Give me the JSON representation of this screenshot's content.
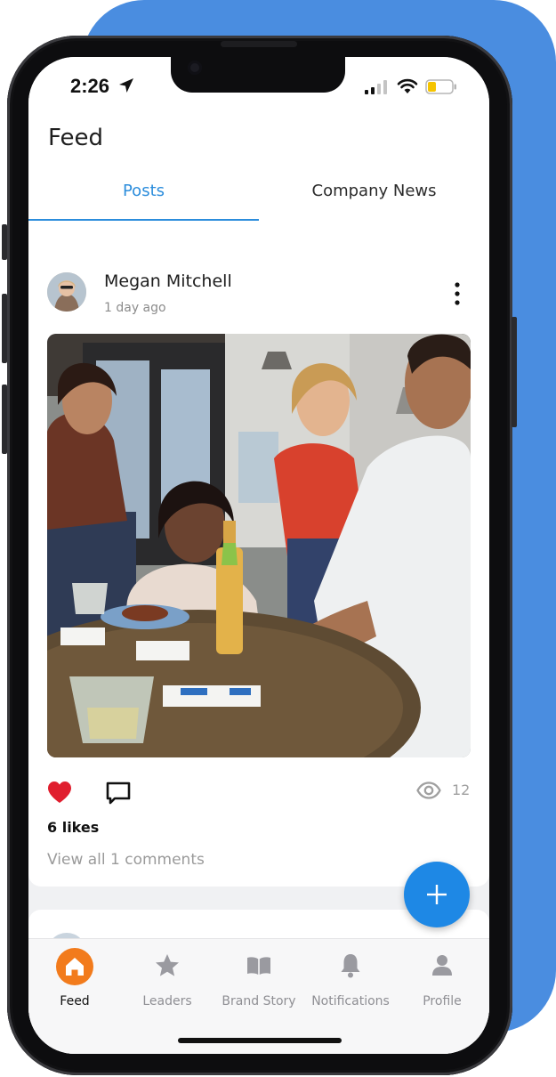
{
  "status_bar": {
    "time": "2:26"
  },
  "header": {
    "title": "Feed",
    "tabs": [
      {
        "label": "Posts",
        "active": true
      },
      {
        "label": "Company News",
        "active": false
      }
    ]
  },
  "post": {
    "author": "Megan Mitchell",
    "time": "1 day ago",
    "likes": "6 likes",
    "views": "12",
    "comments_link": "View all 1 comments"
  },
  "bottom_nav": {
    "items": [
      {
        "label": "Feed",
        "icon": "home-icon",
        "active": true
      },
      {
        "label": "Leaders",
        "icon": "star-icon",
        "active": false
      },
      {
        "label": "Brand Story",
        "icon": "book-icon",
        "active": false
      },
      {
        "label": "Notifications",
        "icon": "bell-icon",
        "active": false
      },
      {
        "label": "Profile",
        "icon": "person-icon",
        "active": false
      }
    ]
  },
  "colors": {
    "accent": "#2c8ddc",
    "fab": "#1e88e5",
    "home_active": "#f27b1c",
    "like": "#e01e2e",
    "backdrop": "#4a8de0"
  }
}
